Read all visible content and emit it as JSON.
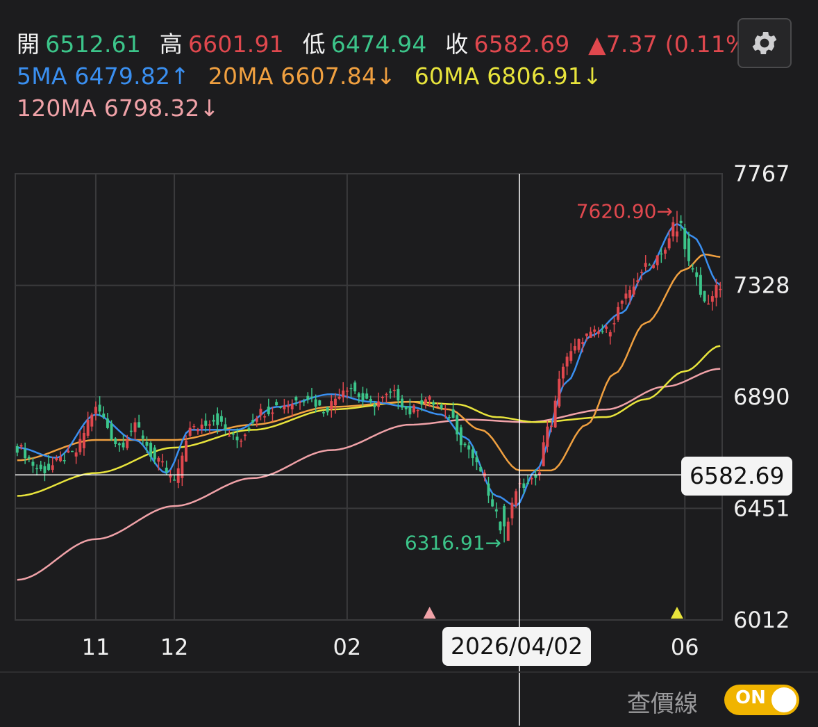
{
  "ohlc": {
    "open_label": "開",
    "open": "6512.61",
    "high_label": "高",
    "high": "6601.91",
    "low_label": "低",
    "low": "6474.94",
    "close_label": "收",
    "close": "6582.69",
    "change": "▲7.37 (0.11%)"
  },
  "ma": {
    "ma5": "5MA 6479.82↑",
    "ma20": "20MA 6607.84↓",
    "ma60": "60MA 6806.91↓",
    "ma120": "120MA 6798.32↓"
  },
  "toggle": {
    "label": "查價線",
    "state": "ON"
  },
  "crosshair": {
    "price": "6582.69",
    "date": "2026/04/02"
  },
  "colors": {
    "up": "#e0484e",
    "down": "#3cc58a",
    "ma5": "#3a8ff0",
    "ma20": "#f0a040",
    "ma60": "#e8e43c",
    "ma120": "#f0a2a8",
    "grid": "#3a3a3c"
  },
  "chart_data": {
    "type": "candlestick",
    "y_ticks": [
      "7767",
      "7328",
      "6890",
      "6451",
      "6012"
    ],
    "ylim": [
      6012,
      7767
    ],
    "x_ticks": [
      {
        "label": "11",
        "index": 20
      },
      {
        "label": "12",
        "index": 40
      },
      {
        "label": "02",
        "index": 84
      },
      {
        "label": "06",
        "index": 170
      }
    ],
    "annotations": {
      "max_label": "7620.90→",
      "max_value": 7620.9,
      "max_index": 168,
      "min_label": "6316.91→",
      "min_value": 6316.91,
      "min_index": 124
    },
    "markers": [
      {
        "type": "triangle",
        "color": "#f0a2a8",
        "index": 105
      },
      {
        "type": "triangle",
        "color": "#e8e43c",
        "index": 168
      }
    ],
    "ohlc_anchors": [
      [
        0,
        6690
      ],
      [
        6,
        6600
      ],
      [
        14,
        6660
      ],
      [
        20,
        6840
      ],
      [
        26,
        6700
      ],
      [
        30,
        6770
      ],
      [
        36,
        6630
      ],
      [
        40,
        6560
      ],
      [
        44,
        6760
      ],
      [
        50,
        6800
      ],
      [
        56,
        6720
      ],
      [
        62,
        6830
      ],
      [
        68,
        6860
      ],
      [
        74,
        6890
      ],
      [
        78,
        6840
      ],
      [
        84,
        6930
      ],
      [
        90,
        6860
      ],
      [
        96,
        6900
      ],
      [
        100,
        6830
      ],
      [
        104,
        6880
      ],
      [
        110,
        6820
      ],
      [
        114,
        6700
      ],
      [
        118,
        6600
      ],
      [
        122,
        6420
      ],
      [
        124,
        6340
      ],
      [
        127,
        6530
      ],
      [
        132,
        6560
      ],
      [
        135,
        6760
      ],
      [
        140,
        7050
      ],
      [
        145,
        7130
      ],
      [
        150,
        7150
      ],
      [
        155,
        7280
      ],
      [
        160,
        7400
      ],
      [
        165,
        7470
      ],
      [
        168,
        7600
      ],
      [
        172,
        7380
      ],
      [
        175,
        7260
      ],
      [
        179,
        7320
      ]
    ],
    "ma5_anchors": [
      [
        0,
        6690
      ],
      [
        10,
        6650
      ],
      [
        20,
        6820
      ],
      [
        30,
        6720
      ],
      [
        38,
        6590
      ],
      [
        44,
        6760
      ],
      [
        56,
        6760
      ],
      [
        66,
        6850
      ],
      [
        80,
        6900
      ],
      [
        90,
        6870
      ],
      [
        100,
        6850
      ],
      [
        108,
        6820
      ],
      [
        114,
        6730
      ],
      [
        122,
        6500
      ],
      [
        127,
        6460
      ],
      [
        132,
        6600
      ],
      [
        140,
        6950
      ],
      [
        146,
        7130
      ],
      [
        154,
        7220
      ],
      [
        160,
        7380
      ],
      [
        168,
        7570
      ],
      [
        172,
        7520
      ],
      [
        179,
        7330
      ]
    ],
    "ma20_anchors": [
      [
        0,
        6640
      ],
      [
        20,
        6720
      ],
      [
        40,
        6720
      ],
      [
        60,
        6780
      ],
      [
        80,
        6850
      ],
      [
        100,
        6870
      ],
      [
        110,
        6840
      ],
      [
        118,
        6760
      ],
      [
        128,
        6600
      ],
      [
        136,
        6600
      ],
      [
        145,
        6780
      ],
      [
        152,
        6980
      ],
      [
        160,
        7180
      ],
      [
        170,
        7390
      ],
      [
        175,
        7450
      ],
      [
        179,
        7440
      ]
    ],
    "ma60_anchors": [
      [
        0,
        6500
      ],
      [
        20,
        6590
      ],
      [
        40,
        6690
      ],
      [
        60,
        6760
      ],
      [
        80,
        6840
      ],
      [
        100,
        6870
      ],
      [
        112,
        6860
      ],
      [
        122,
        6810
      ],
      [
        132,
        6790
      ],
      [
        150,
        6810
      ],
      [
        160,
        6880
      ],
      [
        170,
        6990
      ],
      [
        179,
        7090
      ]
    ],
    "ma120_anchors": [
      [
        0,
        6170
      ],
      [
        20,
        6330
      ],
      [
        40,
        6460
      ],
      [
        60,
        6570
      ],
      [
        80,
        6680
      ],
      [
        100,
        6780
      ],
      [
        115,
        6800
      ],
      [
        130,
        6790
      ],
      [
        150,
        6840
      ],
      [
        165,
        6930
      ],
      [
        179,
        7000
      ]
    ],
    "count": 180
  }
}
